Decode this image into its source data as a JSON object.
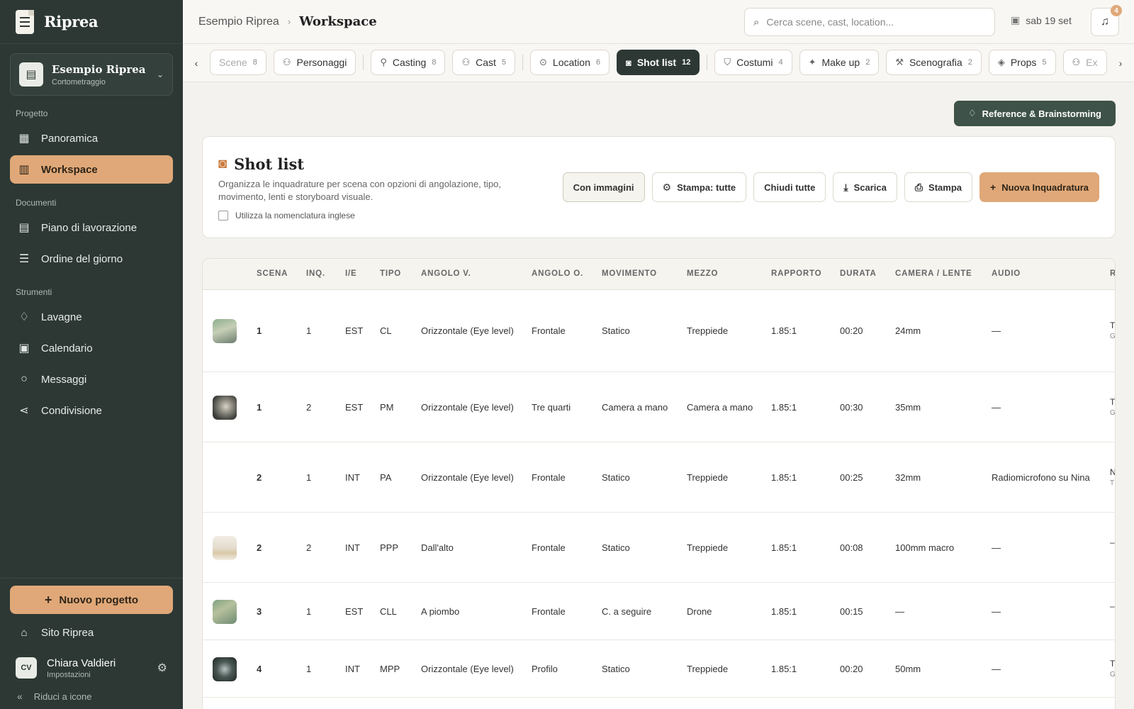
{
  "app": {
    "name": "Riprea"
  },
  "project": {
    "name": "Esempio Riprea",
    "type": "Cortometraggio"
  },
  "sidebar": {
    "sections": {
      "progetto": "Progetto",
      "documenti": "Documenti",
      "strumenti": "Strumenti"
    },
    "items": {
      "panoramica": "Panoramica",
      "workspace": "Workspace",
      "piano": "Piano di lavorazione",
      "ordine": "Ordine del giorno",
      "lavagne": "Lavagne",
      "calendario": "Calendario",
      "messaggi": "Messaggi",
      "condivisione": "Condivisione"
    },
    "new_project": "Nuovo progetto",
    "site_link": "Sito Riprea",
    "user": {
      "initials": "CV",
      "name": "Chiara Valdieri",
      "sub": "Impostazioni"
    },
    "collapse": "Riduci a icone"
  },
  "header": {
    "breadcrumb_root": "Esempio Riprea",
    "breadcrumb_current": "Workspace",
    "search_placeholder": "Cerca scene, cast, location...",
    "date": "sab 19 set",
    "notifications": "4"
  },
  "tabs": [
    {
      "label": "Scene",
      "count": "8"
    },
    {
      "label": "Personaggi",
      "count": ""
    },
    {
      "label": "Casting",
      "count": "8"
    },
    {
      "label": "Cast",
      "count": "5"
    },
    {
      "label": "Location",
      "count": "6"
    },
    {
      "label": "Shot list",
      "count": "12"
    },
    {
      "label": "Costumi",
      "count": "4"
    },
    {
      "label": "Make up",
      "count": "2"
    },
    {
      "label": "Scenografia",
      "count": "2"
    },
    {
      "label": "Props",
      "count": "5"
    },
    {
      "label": "Ex",
      "count": ""
    }
  ],
  "reference_button": "Reference & Brainstorming",
  "panel": {
    "title": "Shot list",
    "description": "Organizza le inquadrature per scena con opzioni di angolazione, tipo, movimento, lenti e storyboard visuale.",
    "checkbox_label": "Utilizza la nomenclatura inglese",
    "actions": {
      "images": "Con immagini",
      "print_all": "Stampa: tutte",
      "close_all": "Chiudi tutte",
      "download": "Scarica",
      "print": "Stampa",
      "new_shot": "Nuova Inquadratura"
    }
  },
  "table": {
    "headers": {
      "scena": "SCENA",
      "inq": "INQ.",
      "ie": "I/E",
      "tipo": "TIPO",
      "angolo_v": "ANGOLO V.",
      "angolo_o": "ANGOLO O.",
      "movimento": "MOVIMENTO",
      "mezzo": "MEZZO",
      "rapporto": "RAPPORTO",
      "durata": "DURATA",
      "camera": "CAMERA / LENTE",
      "audio": "AUDIO",
      "extra": "R"
    },
    "rows": [
      {
        "scena": "1",
        "inq": "1",
        "ie": "EST",
        "tipo": "CL",
        "angolo_v": "Orizzontale (Eye level)",
        "angolo_o": "Frontale",
        "movimento": "Statico",
        "mezzo": "Treppiede",
        "rapporto": "1.85:1",
        "durata": "00:20",
        "camera": "24mm",
        "audio": "—",
        "extra1": "T",
        "extra2": "G"
      },
      {
        "scena": "1",
        "inq": "2",
        "ie": "EST",
        "tipo": "PM",
        "angolo_v": "Orizzontale (Eye level)",
        "angolo_o": "Tre quarti",
        "movimento": "Camera a mano",
        "mezzo": "Camera a mano",
        "rapporto": "1.85:1",
        "durata": "00:30",
        "camera": "35mm",
        "audio": "—",
        "extra1": "T",
        "extra2": "G"
      },
      {
        "scena": "2",
        "inq": "1",
        "ie": "INT",
        "tipo": "PA",
        "angolo_v": "Orizzontale (Eye level)",
        "angolo_o": "Frontale",
        "movimento": "Statico",
        "mezzo": "Treppiede",
        "rapporto": "1.85:1",
        "durata": "00:25",
        "camera": "32mm",
        "audio": "Radiomicrofono su Nina",
        "extra1": "N",
        "extra2": "T"
      },
      {
        "scena": "2",
        "inq": "2",
        "ie": "INT",
        "tipo": "PPP",
        "angolo_v": "Dall'alto",
        "angolo_o": "Frontale",
        "movimento": "Statico",
        "mezzo": "Treppiede",
        "rapporto": "1.85:1",
        "durata": "00:08",
        "camera": "100mm macro",
        "audio": "—",
        "extra1": "–",
        "extra2": ""
      },
      {
        "scena": "3",
        "inq": "1",
        "ie": "EST",
        "tipo": "CLL",
        "angolo_v": "A piombo",
        "angolo_o": "Frontale",
        "movimento": "C. a seguire",
        "mezzo": "Drone",
        "rapporto": "1.85:1",
        "durata": "00:15",
        "camera": "—",
        "audio": "—",
        "extra1": "–",
        "extra2": ""
      },
      {
        "scena": "4",
        "inq": "1",
        "ie": "INT",
        "tipo": "MPP",
        "angolo_v": "Orizzontale (Eye level)",
        "angolo_o": "Profilo",
        "movimento": "Statico",
        "mezzo": "Treppiede",
        "rapporto": "1.85:1",
        "durata": "00:20",
        "camera": "50mm",
        "audio": "—",
        "extra1": "T",
        "extra2": "G"
      }
    ]
  }
}
